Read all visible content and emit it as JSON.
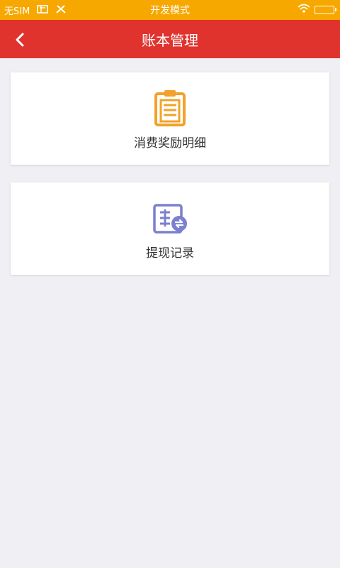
{
  "status_bar": {
    "carrier": "无SIM",
    "mode": "开发模式",
    "icons": [
      "sim-card-icon",
      "tools-icon",
      "wifi-icon",
      "battery-icon"
    ]
  },
  "navbar": {
    "title": "账本管理",
    "back_icon": "chevron-left-icon"
  },
  "menu": [
    {
      "label": "消费奖励明细",
      "icon": "clipboard-icon",
      "icon_color": "#f2a22a"
    },
    {
      "label": "提现记录",
      "icon": "withdraw-record-icon",
      "icon_color": "#7b80cf"
    }
  ],
  "colors": {
    "status_bar": "#f6a800",
    "navbar": "#e0332e",
    "background": "#efeff4"
  }
}
